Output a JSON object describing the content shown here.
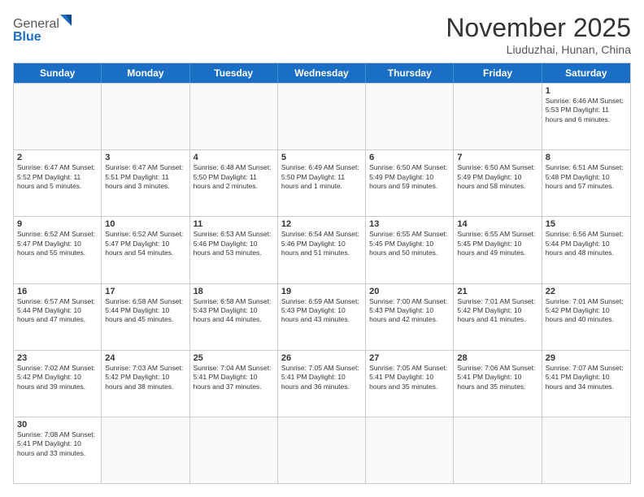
{
  "header": {
    "logo_general": "General",
    "logo_blue": "Blue",
    "month_title": "November 2025",
    "location": "Liuduzhai, Hunan, China"
  },
  "days_of_week": [
    "Sunday",
    "Monday",
    "Tuesday",
    "Wednesday",
    "Thursday",
    "Friday",
    "Saturday"
  ],
  "weeks": [
    [
      {
        "day": "",
        "info": ""
      },
      {
        "day": "",
        "info": ""
      },
      {
        "day": "",
        "info": ""
      },
      {
        "day": "",
        "info": ""
      },
      {
        "day": "",
        "info": ""
      },
      {
        "day": "",
        "info": ""
      },
      {
        "day": "1",
        "info": "Sunrise: 6:46 AM\nSunset: 5:53 PM\nDaylight: 11 hours and 6 minutes."
      }
    ],
    [
      {
        "day": "2",
        "info": "Sunrise: 6:47 AM\nSunset: 5:52 PM\nDaylight: 11 hours and 5 minutes."
      },
      {
        "day": "3",
        "info": "Sunrise: 6:47 AM\nSunset: 5:51 PM\nDaylight: 11 hours and 3 minutes."
      },
      {
        "day": "4",
        "info": "Sunrise: 6:48 AM\nSunset: 5:50 PM\nDaylight: 11 hours and 2 minutes."
      },
      {
        "day": "5",
        "info": "Sunrise: 6:49 AM\nSunset: 5:50 PM\nDaylight: 11 hours and 1 minute."
      },
      {
        "day": "6",
        "info": "Sunrise: 6:50 AM\nSunset: 5:49 PM\nDaylight: 10 hours and 59 minutes."
      },
      {
        "day": "7",
        "info": "Sunrise: 6:50 AM\nSunset: 5:49 PM\nDaylight: 10 hours and 58 minutes."
      },
      {
        "day": "8",
        "info": "Sunrise: 6:51 AM\nSunset: 5:48 PM\nDaylight: 10 hours and 57 minutes."
      }
    ],
    [
      {
        "day": "9",
        "info": "Sunrise: 6:52 AM\nSunset: 5:47 PM\nDaylight: 10 hours and 55 minutes."
      },
      {
        "day": "10",
        "info": "Sunrise: 6:52 AM\nSunset: 5:47 PM\nDaylight: 10 hours and 54 minutes."
      },
      {
        "day": "11",
        "info": "Sunrise: 6:53 AM\nSunset: 5:46 PM\nDaylight: 10 hours and 53 minutes."
      },
      {
        "day": "12",
        "info": "Sunrise: 6:54 AM\nSunset: 5:46 PM\nDaylight: 10 hours and 51 minutes."
      },
      {
        "day": "13",
        "info": "Sunrise: 6:55 AM\nSunset: 5:45 PM\nDaylight: 10 hours and 50 minutes."
      },
      {
        "day": "14",
        "info": "Sunrise: 6:55 AM\nSunset: 5:45 PM\nDaylight: 10 hours and 49 minutes."
      },
      {
        "day": "15",
        "info": "Sunrise: 6:56 AM\nSunset: 5:44 PM\nDaylight: 10 hours and 48 minutes."
      }
    ],
    [
      {
        "day": "16",
        "info": "Sunrise: 6:57 AM\nSunset: 5:44 PM\nDaylight: 10 hours and 47 minutes."
      },
      {
        "day": "17",
        "info": "Sunrise: 6:58 AM\nSunset: 5:44 PM\nDaylight: 10 hours and 45 minutes."
      },
      {
        "day": "18",
        "info": "Sunrise: 6:58 AM\nSunset: 5:43 PM\nDaylight: 10 hours and 44 minutes."
      },
      {
        "day": "19",
        "info": "Sunrise: 6:59 AM\nSunset: 5:43 PM\nDaylight: 10 hours and 43 minutes."
      },
      {
        "day": "20",
        "info": "Sunrise: 7:00 AM\nSunset: 5:43 PM\nDaylight: 10 hours and 42 minutes."
      },
      {
        "day": "21",
        "info": "Sunrise: 7:01 AM\nSunset: 5:42 PM\nDaylight: 10 hours and 41 minutes."
      },
      {
        "day": "22",
        "info": "Sunrise: 7:01 AM\nSunset: 5:42 PM\nDaylight: 10 hours and 40 minutes."
      }
    ],
    [
      {
        "day": "23",
        "info": "Sunrise: 7:02 AM\nSunset: 5:42 PM\nDaylight: 10 hours and 39 minutes."
      },
      {
        "day": "24",
        "info": "Sunrise: 7:03 AM\nSunset: 5:42 PM\nDaylight: 10 hours and 38 minutes."
      },
      {
        "day": "25",
        "info": "Sunrise: 7:04 AM\nSunset: 5:41 PM\nDaylight: 10 hours and 37 minutes."
      },
      {
        "day": "26",
        "info": "Sunrise: 7:05 AM\nSunset: 5:41 PM\nDaylight: 10 hours and 36 minutes."
      },
      {
        "day": "27",
        "info": "Sunrise: 7:05 AM\nSunset: 5:41 PM\nDaylight: 10 hours and 35 minutes."
      },
      {
        "day": "28",
        "info": "Sunrise: 7:06 AM\nSunset: 5:41 PM\nDaylight: 10 hours and 35 minutes."
      },
      {
        "day": "29",
        "info": "Sunrise: 7:07 AM\nSunset: 5:41 PM\nDaylight: 10 hours and 34 minutes."
      }
    ],
    [
      {
        "day": "30",
        "info": "Sunrise: 7:08 AM\nSunset: 5:41 PM\nDaylight: 10 hours and 33 minutes."
      },
      {
        "day": "",
        "info": ""
      },
      {
        "day": "",
        "info": ""
      },
      {
        "day": "",
        "info": ""
      },
      {
        "day": "",
        "info": ""
      },
      {
        "day": "",
        "info": ""
      },
      {
        "day": "",
        "info": ""
      }
    ]
  ]
}
